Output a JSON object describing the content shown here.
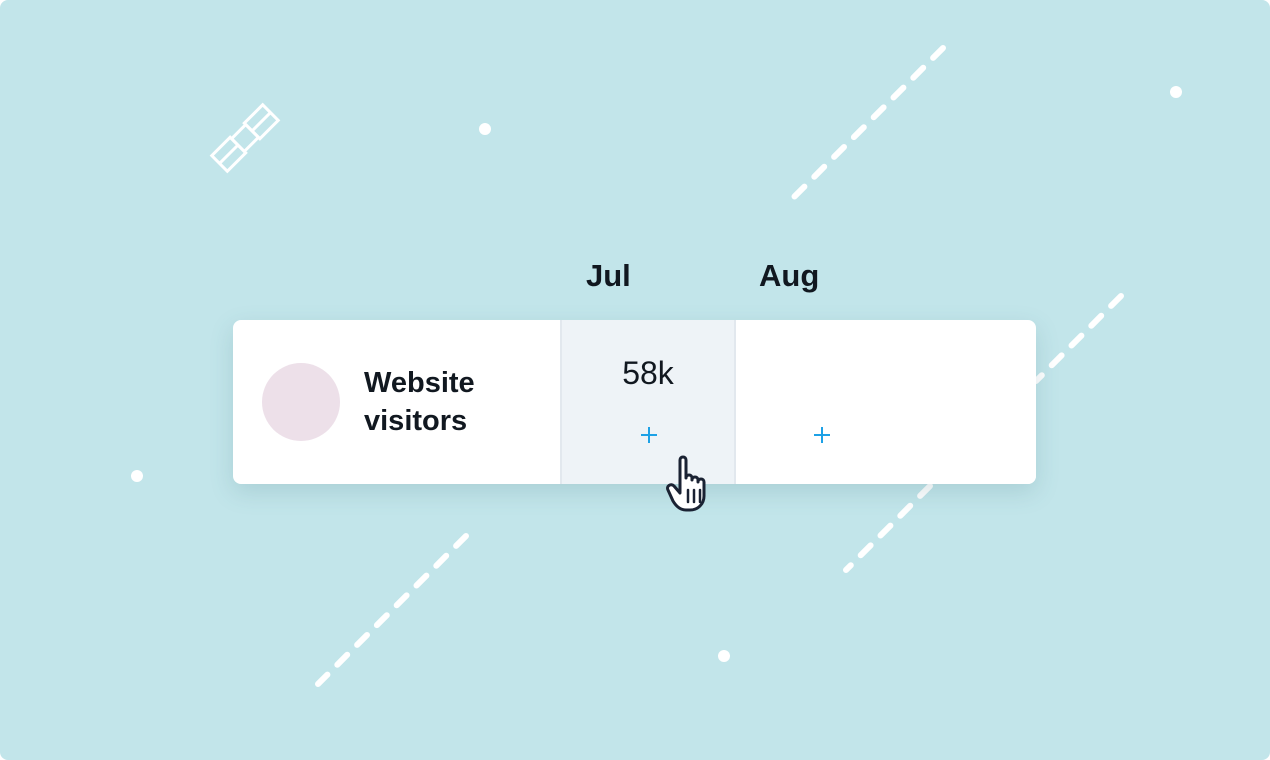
{
  "months": {
    "jul": "Jul",
    "aug": "Aug"
  },
  "metric": {
    "name_line1": "Website",
    "name_line2": "visitors",
    "jul_value": "58k",
    "aug_value": ""
  },
  "icons": {
    "satellite": "satellite-icon",
    "add": "plus-icon",
    "cursor": "hand-pointer-icon"
  },
  "colors": {
    "background": "#c2e5ea",
    "card": "#ffffff",
    "highlight_cell": "#eef3f7",
    "avatar": "#ede0e9",
    "accent": "#1da1e6",
    "text": "#111820"
  }
}
